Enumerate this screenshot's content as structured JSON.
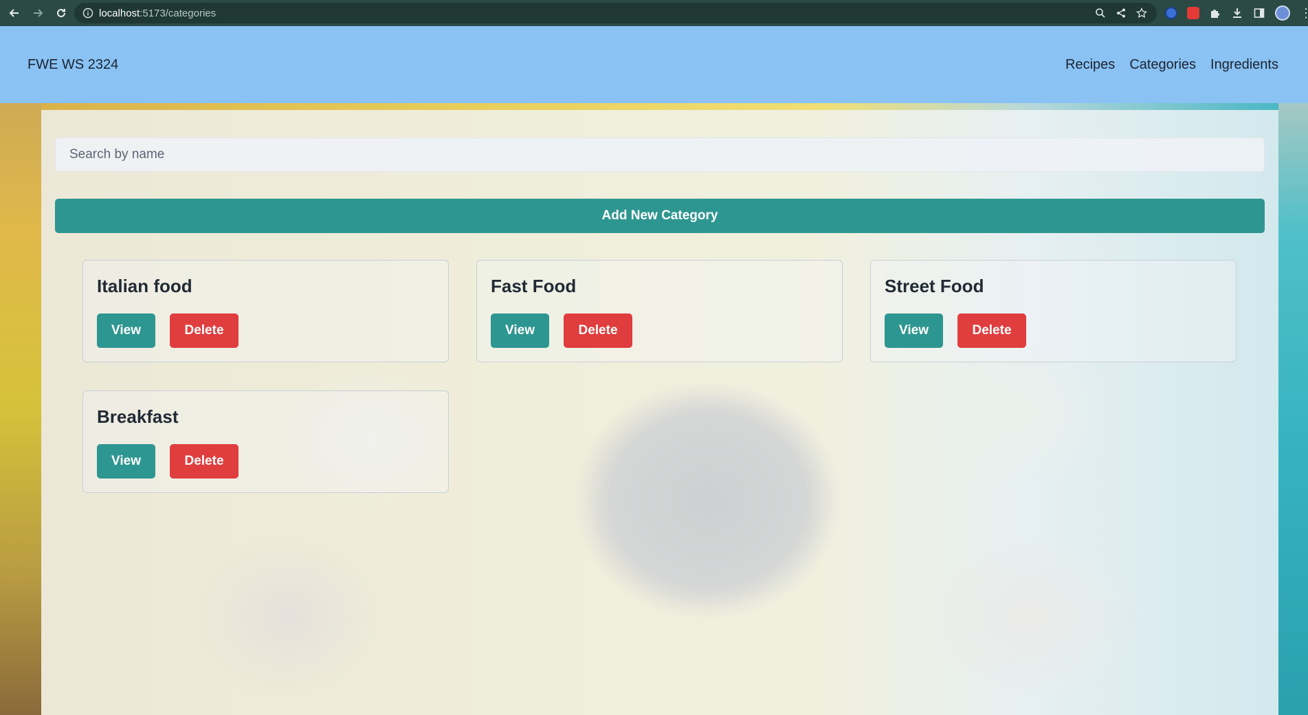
{
  "browser": {
    "url_host": "localhost",
    "url_path": ":5173/categories"
  },
  "navbar": {
    "brand": "FWE WS 2324",
    "links": [
      "Recipes",
      "Categories",
      "Ingredients"
    ]
  },
  "search": {
    "placeholder": "Search by name",
    "value": ""
  },
  "add_button_label": "Add New Category",
  "categories": [
    {
      "name": "Italian food",
      "view_label": "View",
      "delete_label": "Delete"
    },
    {
      "name": "Fast Food",
      "view_label": "View",
      "delete_label": "Delete"
    },
    {
      "name": "Street Food",
      "view_label": "View",
      "delete_label": "Delete"
    },
    {
      "name": "Breakfast",
      "view_label": "View",
      "delete_label": "Delete"
    }
  ],
  "colors": {
    "navbar": "#89c2f3",
    "primary": "#2e9690",
    "danger": "#e03d3e"
  }
}
